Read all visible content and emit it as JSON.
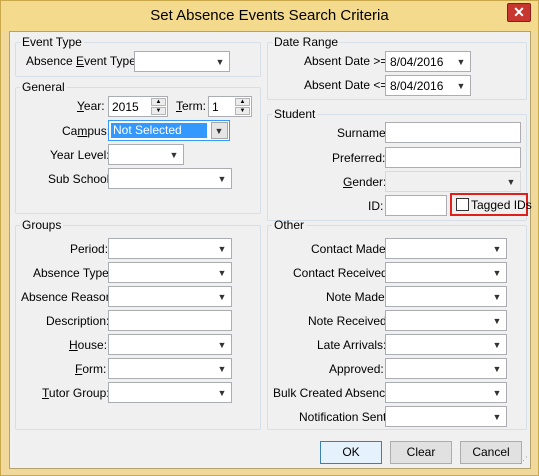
{
  "window": {
    "title": "Set Absence Events Search Criteria",
    "close_label": "✕"
  },
  "event_type": {
    "legend": "Event Type",
    "absence_event_type_pre": "Absence ",
    "absence_event_type_u": "E",
    "absence_event_type_post": "vent Type:",
    "value": ""
  },
  "date_range": {
    "legend": "Date Range",
    "from_label": "Absent Date >=",
    "from_value": "8/04/2016",
    "to_label": "Absent Date <=",
    "to_value": "8/04/2016"
  },
  "general": {
    "legend": "General",
    "year_u": "Y",
    "year_rest": "ear:",
    "year_value": "2015",
    "term_u": "T",
    "term_rest": "erm:",
    "term_value": "1",
    "campus_pre": "Ca",
    "campus_u": "m",
    "campus_post": "pus:",
    "campus_value": "Not Selected",
    "year_level_label": "Year Level:",
    "year_level_value": "",
    "sub_school_label": "Sub School:",
    "sub_school_value": ""
  },
  "student": {
    "legend": "Student",
    "surname_label": "Surname:",
    "preferred_label": "Preferred:",
    "gender_u": "G",
    "gender_rest": "ender:",
    "id_label": "ID:",
    "tagged_label": "Tagged IDs"
  },
  "groups": {
    "legend": "Groups",
    "period_label": "Period:",
    "absence_type_label": "Absence Type:",
    "absence_reason_label": "Absence Reason:",
    "description_label": "Description:",
    "house_u": "H",
    "house_rest": "ouse:",
    "form_u": "F",
    "form_rest": "orm:",
    "tutor_u": "T",
    "tutor_rest": "utor Group:"
  },
  "other": {
    "legend": "Other",
    "contact_made_label": "Contact Made:",
    "contact_received_label": "Contact Received:",
    "note_made_label": "Note Made:",
    "note_received_label": "Note Received:",
    "late_arrivals_label": "Late Arrivals:",
    "approved_label": "Approved:",
    "bulk_created_label": "Bulk Created Absence:",
    "notification_sent_label": "Notification Sent:"
  },
  "buttons": {
    "ok": "OK",
    "clear": "Clear",
    "cancel": "Cancel"
  },
  "icons": {
    "dropdown": "chevron-down-icon",
    "spin_up": "spin-up-icon",
    "spin_down": "spin-down-icon",
    "close": "close-icon"
  }
}
